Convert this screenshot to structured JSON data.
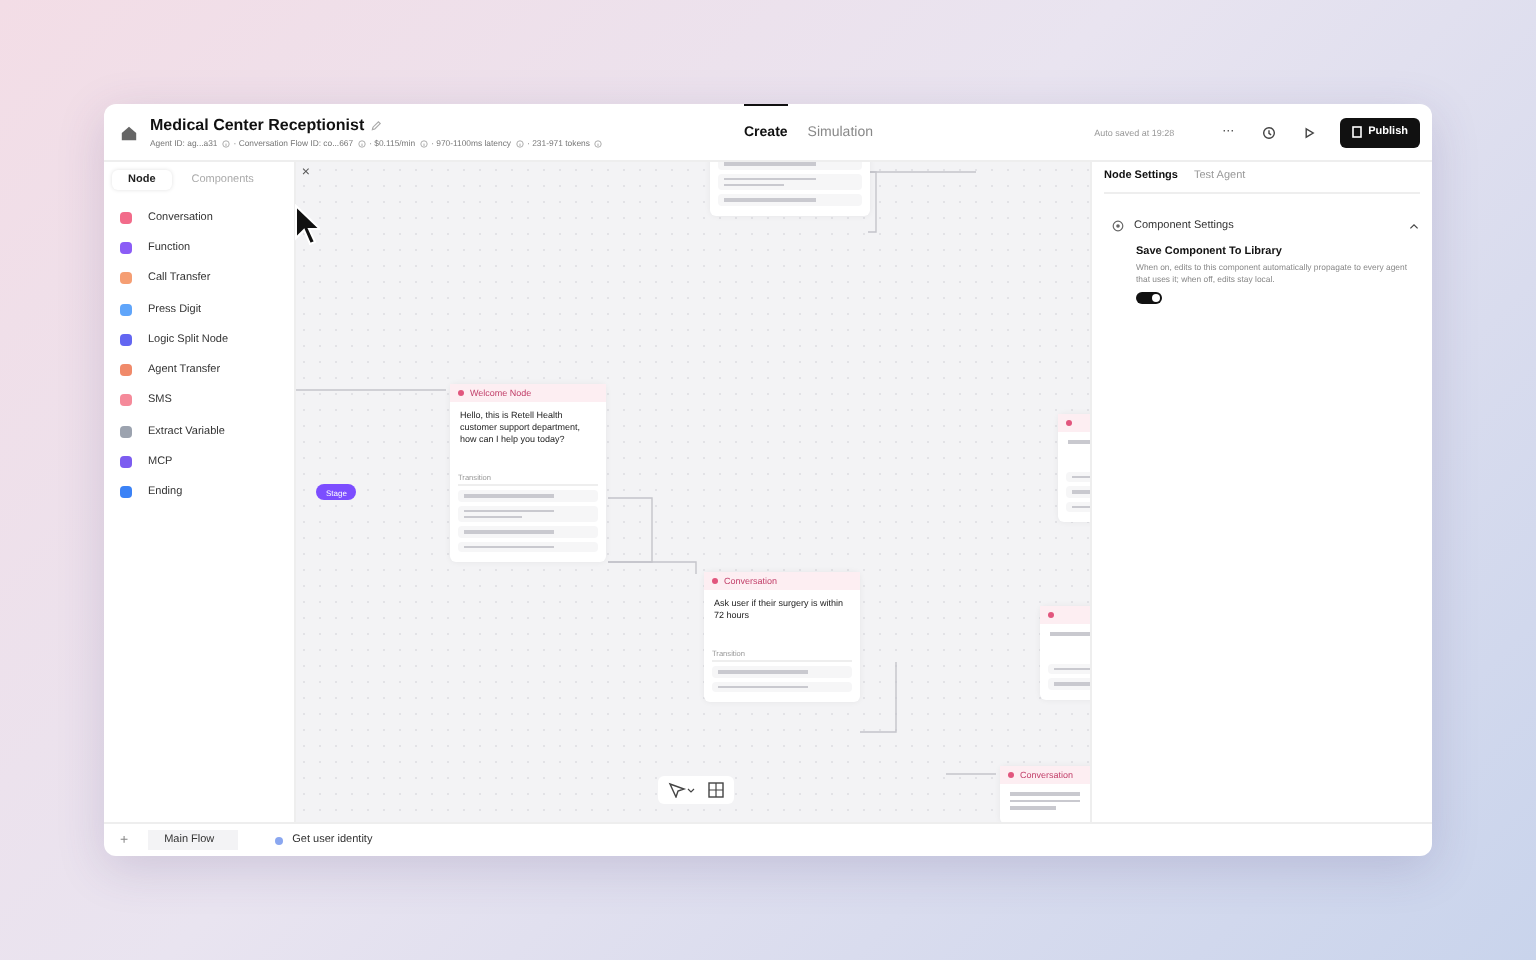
{
  "header": {
    "title": "Medical Center Receptionist",
    "meta": [
      {
        "text": "Agent ID: ag...a31"
      },
      {
        "text": "· Conversation Flow ID: co...667"
      },
      {
        "text": "· $0.115/min"
      },
      {
        "text": "· 970-1100ms latency"
      },
      {
        "text": "· 231-971 tokens"
      }
    ],
    "tabs": [
      {
        "label": "Create",
        "selected": true
      },
      {
        "label": "Simulation",
        "selected": false
      }
    ],
    "autosave": "Auto saved at 19:28",
    "more": "···",
    "publish": "Publish"
  },
  "palette": {
    "tabs": [
      {
        "label": "Node",
        "selected": true
      },
      {
        "label": "Components",
        "selected": false
      }
    ],
    "close": "×",
    "items": [
      {
        "label": "Conversation",
        "color": "#f26b8a"
      },
      {
        "label": "Function",
        "color": "#8b5cf6"
      },
      {
        "label": "Call Transfer",
        "color": "#f59e73"
      },
      {
        "label": "Press Digit",
        "color": "#60a5fa"
      },
      {
        "label": "Logic Split Node",
        "color": "#6366f1"
      },
      {
        "label": "Agent Transfer",
        "color": "#f08a6a"
      },
      {
        "label": "SMS",
        "color": "#f58a9a"
      },
      {
        "label": "Extract Variable",
        "color": "#9ca3af"
      },
      {
        "label": "MCP",
        "color": "#7c5cf0"
      },
      {
        "label": "Ending",
        "color": "#3b82f6"
      }
    ]
  },
  "canvas": {
    "stage": "Stage",
    "nodes": [
      {
        "kind": "edges",
        "edges": [
          {
            "long": false
          },
          {
            "long": true
          },
          {
            "long": false
          }
        ]
      },
      {
        "kind": "full",
        "title": "Welcome Node",
        "body": "Hello, this is Retell Health customer support department, how can I help you today?",
        "transition": "Transition",
        "edges": [
          {
            "long": false
          },
          {
            "long": true
          },
          {
            "long": false
          },
          {
            "long": false
          }
        ]
      },
      {
        "kind": "full",
        "title": "Conversation",
        "body": "Ask user if their surgery is within 72 hours",
        "transition": "Transition",
        "edges": [
          {
            "long": false
          },
          {
            "long": false
          }
        ]
      },
      {
        "kind": "partial",
        "edges": [
          {
            "long": false
          },
          {
            "long": false
          },
          {
            "long": false
          }
        ]
      },
      {
        "kind": "partial",
        "edges": [
          {
            "long": false
          },
          {
            "long": false
          }
        ]
      },
      {
        "kind": "titled",
        "title": "Conversation"
      }
    ]
  },
  "settings": {
    "tabs": [
      {
        "label": "Node Settings",
        "selected": true
      },
      {
        "label": "Test Agent",
        "selected": false
      }
    ],
    "section": {
      "title": "Component Settings",
      "expanded": true,
      "option": {
        "title": "Save Component To Library",
        "description": "When on, edits to this component automatically propagate to every agent that uses it; when off, edits stay local.",
        "on": true
      }
    }
  },
  "footer": {
    "add": "+",
    "tabs": [
      {
        "label": "Main Flow",
        "selected": true
      },
      {
        "label": "Get user identity",
        "selected": false
      }
    ]
  }
}
